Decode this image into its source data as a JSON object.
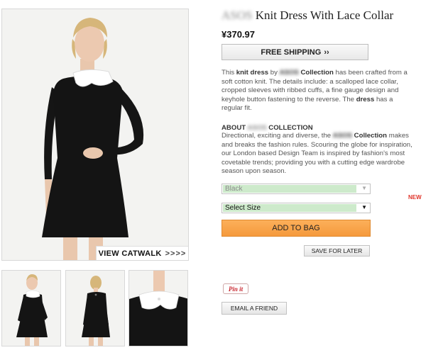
{
  "product": {
    "brand_redacted": "ASOS",
    "title_rest": " Knit Dress With Lace Collar",
    "price": "¥370.97"
  },
  "shipping": {
    "label": "FREE SHIPPING",
    "arrow": "››"
  },
  "description": {
    "p1": "This ",
    "b1": "knit dress",
    "p2": " by ",
    "brand_redacted": "ASOS",
    "b2": " Collection",
    "p3": " has been crafted from a soft cotton knit. The details include: a scalloped lace collar, cropped sleeves with ribbed cuffs, a fine gauge design and keyhole button fastening to the reverse. The ",
    "b3": "dress",
    "p4": " has a regular fit."
  },
  "about": {
    "heading_start": "ABOUT ",
    "brand_redacted": "ASOS",
    "heading_end": " COLLECTION",
    "t1": "Directional, exciting and diverse, the ",
    "brand_redacted2": "ASOS",
    "b1": " Collection",
    "t2": " makes and breaks the fashion rules. Scouring the globe for inspiration, our London based Design Team is inspired by fashion's most covetable trends; providing you with a cutting edge wardrobe season upon season."
  },
  "options": {
    "colour": {
      "selected": "Black",
      "caret": "▼"
    },
    "size": {
      "selected": "Select Size",
      "caret": "▼"
    }
  },
  "badge": {
    "new": "NEW"
  },
  "buttons": {
    "add_to_bag": "ADD TO BAG",
    "save_for_later": "SAVE FOR LATER",
    "pin_it": "Pin it",
    "email_friend": "EMAIL A FRIEND"
  },
  "gallery": {
    "view_catwalk": "VIEW CATWALK",
    "arrows": ">>>>"
  },
  "colors": {
    "accent_orange": "#f7a54b",
    "select_highlight": "#cdeacb",
    "new_red": "#e0342a",
    "dress_black": "#141414"
  }
}
